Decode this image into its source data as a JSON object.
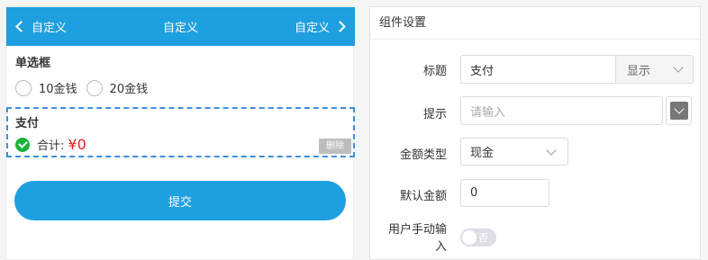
{
  "preview": {
    "header": {
      "back_label": "自定义",
      "title": "自定义",
      "forward_label": "自定义"
    },
    "radio_group": {
      "title": "单选框",
      "options": [
        "10金钱",
        "20金钱"
      ]
    },
    "pay": {
      "title": "支付",
      "total_label": "合计:",
      "total_amount": "¥0",
      "delete_label": "删除"
    },
    "submit_label": "提交"
  },
  "settings": {
    "header": "组件设置",
    "title_label": "标题",
    "title_value": "支付",
    "title_visibility": "显示",
    "hint_label": "提示",
    "hint_placeholder": "请输入",
    "amount_type_label": "金额类型",
    "amount_type_value": "现金",
    "default_amount_label": "默认金额",
    "default_amount_value": "0",
    "manual_input_label_1": "用户手动输",
    "manual_input_label_2": "入",
    "manual_input_state": "否"
  },
  "colors": {
    "primary": "#1e9fe0",
    "dashed_border": "#3d8fe0",
    "price": "#e02020",
    "check": "#1ab33a"
  }
}
